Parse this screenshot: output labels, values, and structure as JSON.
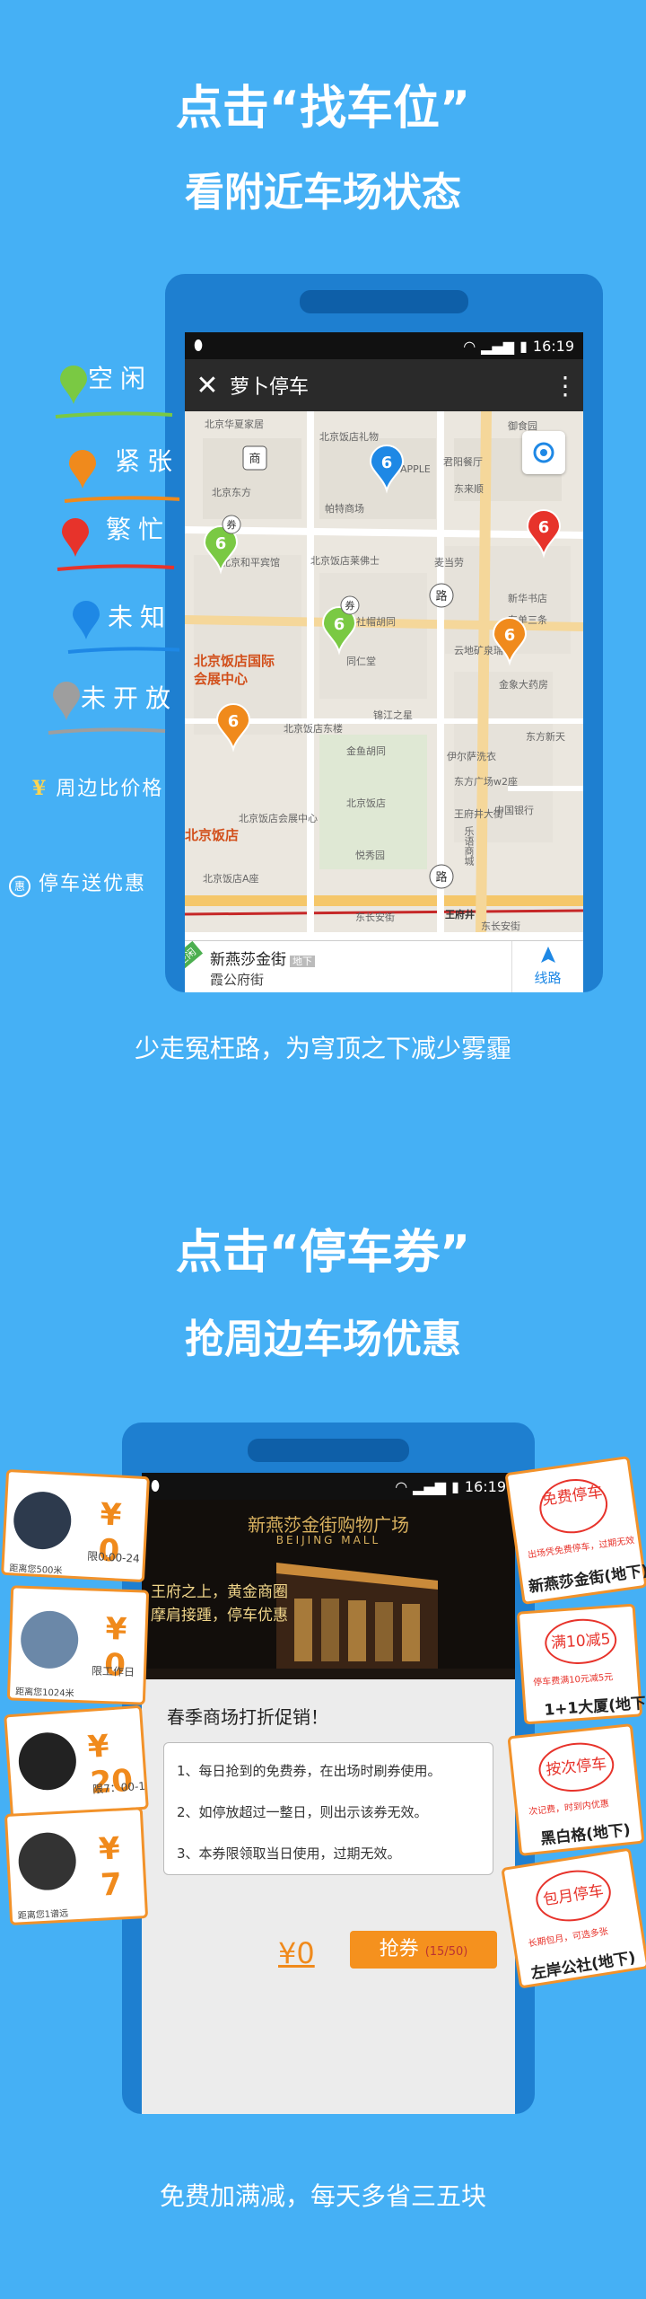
{
  "section1": {
    "headline": "点击“找车位”",
    "subheadline": "看附近车场状态",
    "caption": "少走冤枉路，为穹顶之下减少雾霾"
  },
  "legend": [
    {
      "label": "空闲",
      "color": "#7ac943"
    },
    {
      "label": "紧张",
      "color": "#f08a1c"
    },
    {
      "label": "繁忙",
      "color": "#e7332b"
    },
    {
      "label": "未知",
      "color": "#1e88e5"
    },
    {
      "label": "未开放",
      "color": "#9e9e9e"
    },
    {
      "label": "周边比价格",
      "color": "#ffd54f"
    },
    {
      "label": "停车送优惠",
      "color": "#ffffff"
    }
  ],
  "phone1": {
    "status_time": "16:19",
    "app_title": "萝卜停车",
    "map": {
      "labels": [
        "北京饭店国际会展中心",
        "东单三条",
        "大社帽胡同",
        "东长安街",
        "王府井",
        "金鱼胡同",
        "王府井大街",
        "东方新天",
        "东方广场w2座",
        "中国银行",
        "新华书店",
        "金象大药房",
        "伊尔萨洗衣",
        "麦当劳",
        "同仁堂",
        "锦江之星",
        "北京饭店",
        "北京饭店莱佛士",
        "云地矿泉瑞",
        "乐语商城",
        "北京饭店东楼",
        "北京饭店贵宾楼",
        "北京和平宾馆",
        "北京华夏家居",
        "北京饭店礼物",
        "APPLE",
        "东来顺",
        "君阳餐厅",
        "御食园",
        "北京东方",
        "帕特商场",
        "北京饭店会展中心",
        "北京饭店A座",
        "悦秀园"
      ],
      "pins": [
        {
          "count": "6",
          "color": "#1e88e5"
        },
        {
          "count": "6",
          "color": "#7ac943",
          "coupon": "券"
        },
        {
          "count": "6",
          "color": "#e7332b"
        },
        {
          "count": "6",
          "color": "#7ac943",
          "coupon": "券"
        },
        {
          "count": "6",
          "color": "#f08a1c"
        },
        {
          "count": "6",
          "color": "#f08a1c"
        }
      ],
      "markers": [
        "商",
        "路",
        "路"
      ]
    },
    "sheet": {
      "flag": "空闲",
      "name": "新燕莎金街",
      "tag": "地下",
      "address": "霞公府街",
      "route_label": "线路"
    }
  },
  "section2": {
    "headline": "点击“停车券”",
    "subheadline": "抢周边车场优惠",
    "caption": "免费加满减，每天多省三五块"
  },
  "phone2": {
    "status_time": "16:19",
    "banner": {
      "brand": "新燕莎金街购物广场",
      "brand_en": "BEIJING MALL",
      "slogan_line1": "王府之上，黄金商圈",
      "slogan_line2": "摩肩接踵，停车优惠"
    },
    "promo_title": "春季商场打折促销！",
    "rules": [
      "1、每日抢到的免费券，在出场时刷券使用。",
      "2、如停放超过一整日，则出示该券无效。",
      "3、本券限领取当日使用，过期无效。"
    ],
    "price": "¥0",
    "grab_label": "抢券",
    "grab_count": "(15/50)"
  },
  "left_coupons": [
    {
      "value": "¥ 0",
      "note": "限0:00-24",
      "distance": "距离您500米"
    },
    {
      "value": "¥ 0",
      "note": "限工作日",
      "distance": "距离您1024米"
    },
    {
      "value": "¥ 20",
      "note": "限7：00-1",
      "distance": ""
    },
    {
      "value": "¥ 7",
      "note": "",
      "distance": "距离您1谱远"
    }
  ],
  "right_coupons": [
    {
      "stamp": "免费停车",
      "note": "出场凭免费停车，过期无效",
      "name": "新燕莎金街(地下)"
    },
    {
      "stamp": "满10减5",
      "note": "停车费满10元减5元",
      "name": "1+1大厦(地下)"
    },
    {
      "stamp": "按次停车",
      "note": "次记费，时到内优惠",
      "name": "黑白格(地下)"
    },
    {
      "stamp": "包月停车",
      "note": "长期包月，可选多张",
      "name": "左岸公社(地下)"
    }
  ]
}
